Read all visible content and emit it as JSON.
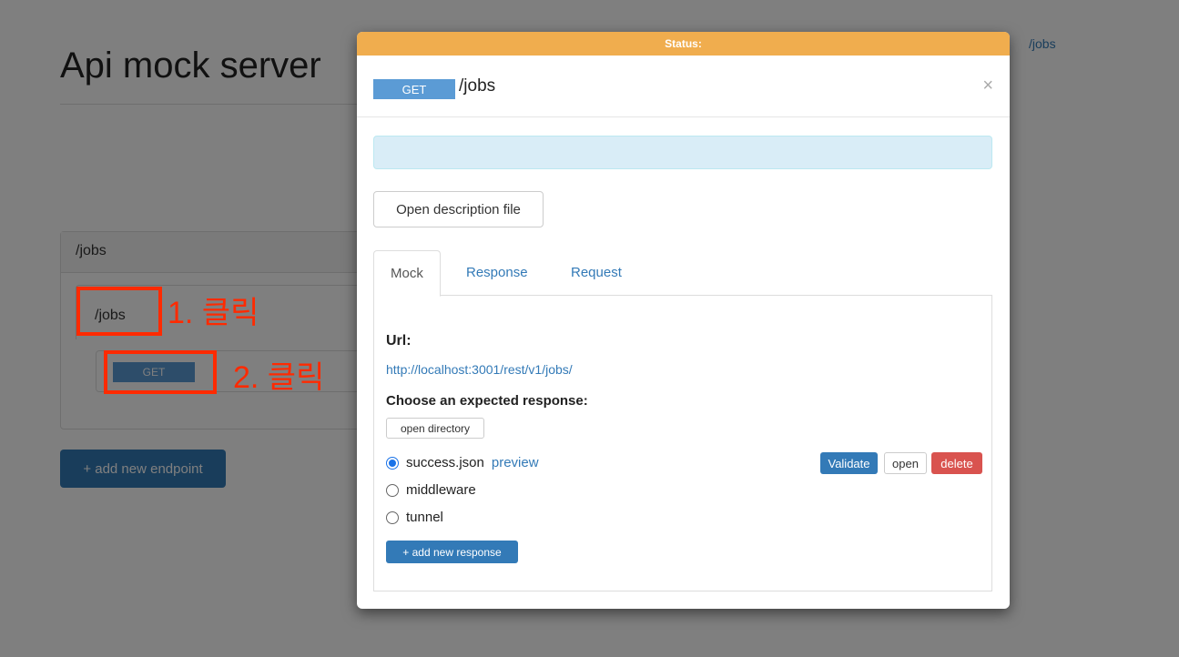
{
  "page": {
    "title": "Api mock server",
    "nav_link": "/jobs",
    "endpoint_group": "/jobs",
    "endpoint_path": "/jobs",
    "method": "GET",
    "add_endpoint_label": "+ add new endpoint"
  },
  "annotations": {
    "step1": "1. 클릭",
    "step2": "2. 클릭",
    "color": "#ff2a00"
  },
  "modal": {
    "status_label": "Status:",
    "method": "GET",
    "title": "/jobs",
    "close_symbol": "×",
    "open_description_label": "Open description file",
    "tabs": [
      {
        "label": "Mock",
        "active": true
      },
      {
        "label": "Response",
        "active": false
      },
      {
        "label": "Request",
        "active": false
      }
    ],
    "url_label": "Url:",
    "url_value": "http://localhost:3001/rest/v1/jobs/",
    "choose_label": "Choose an expected response:",
    "open_directory_label": "open directory",
    "responses": [
      {
        "name": "success.json",
        "selected": true,
        "preview_label": "preview"
      },
      {
        "name": "middleware",
        "selected": false
      },
      {
        "name": "tunnel",
        "selected": false
      }
    ],
    "validate_label": "Validate",
    "open_label": "open",
    "delete_label": "delete",
    "add_response_label": "+ add new response"
  },
  "colors": {
    "status_bar": "#f0ad4e",
    "primary": "#337ab7",
    "danger": "#d9534f",
    "info_alert": "#d9edf7",
    "method_badge": "#5b9bd5"
  }
}
